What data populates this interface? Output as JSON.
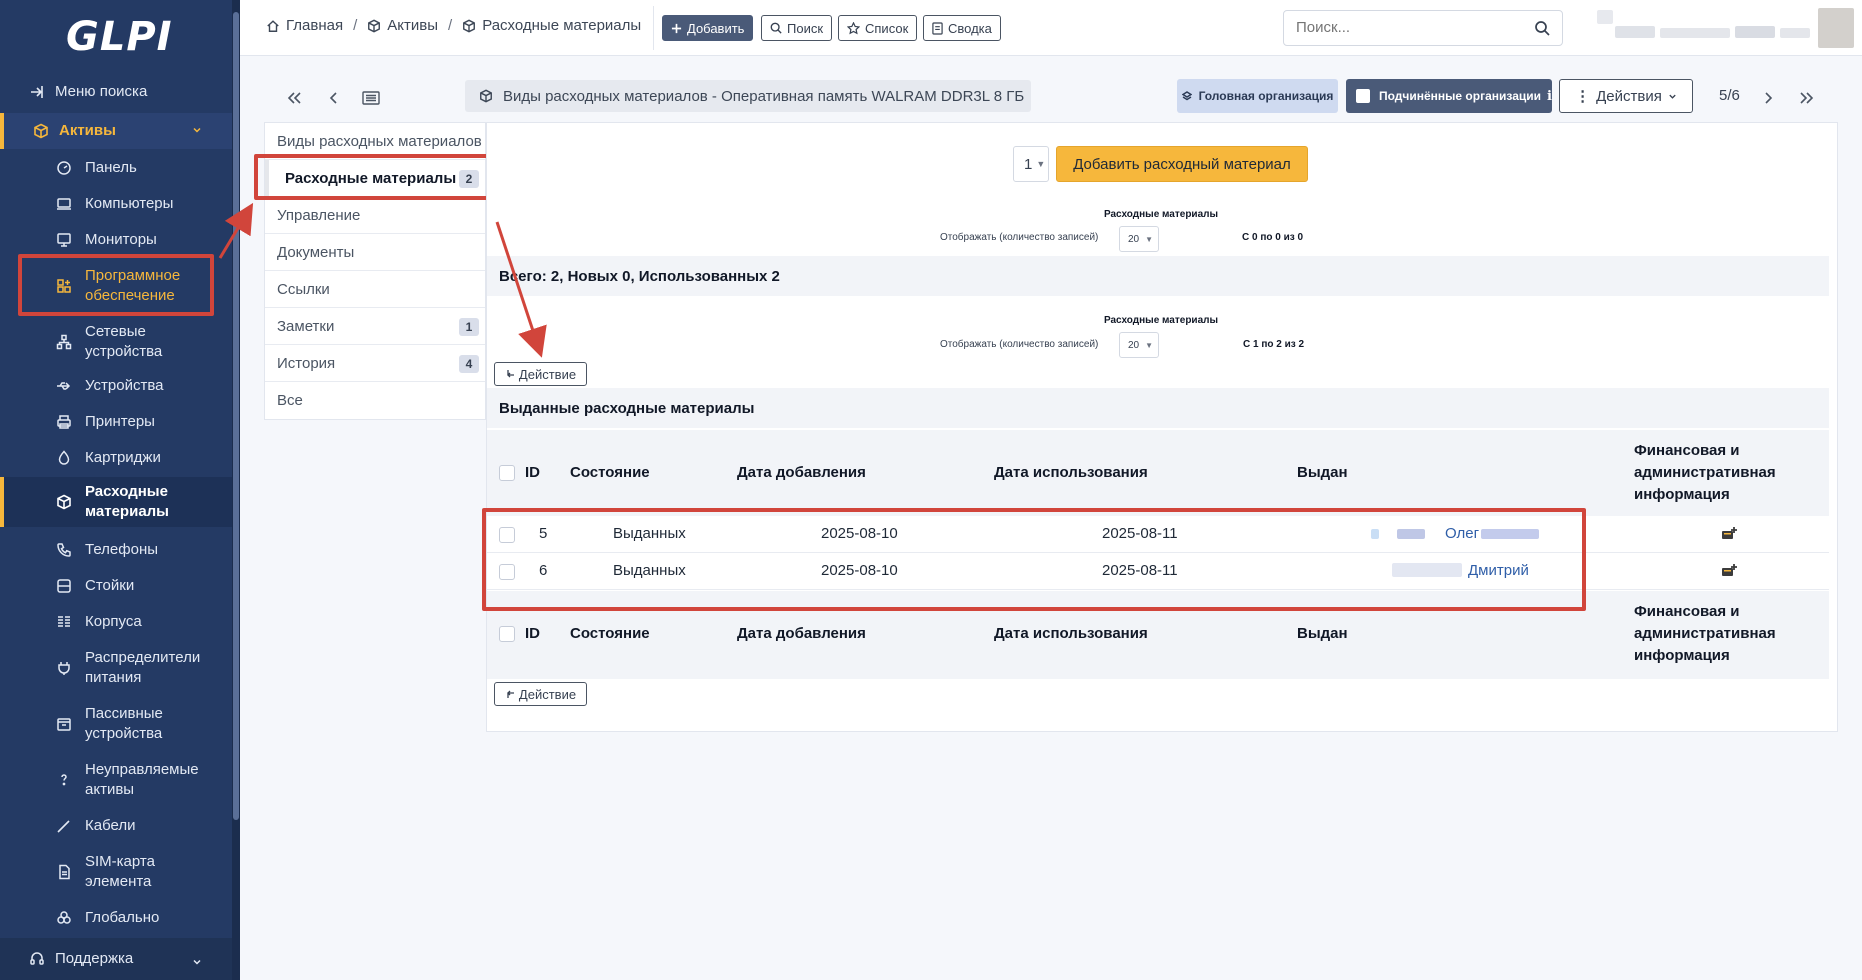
{
  "sidebar": {
    "logo": "GLPI",
    "search_menu": "Меню поиска",
    "section": "Активы",
    "items": [
      {
        "label": "Панель",
        "icon": "dashboard-icon"
      },
      {
        "label": "Компьютеры",
        "icon": "computer-icon"
      },
      {
        "label": "Мониторы",
        "icon": "monitor-icon"
      },
      {
        "label": "Программное обеспечение",
        "icon": "apps-icon"
      },
      {
        "label": "Сетевые устройства",
        "icon": "network-icon"
      },
      {
        "label": "Устройства",
        "icon": "usb-icon"
      },
      {
        "label": "Принтеры",
        "icon": "printer-icon"
      },
      {
        "label": "Картриджи",
        "icon": "droplet-icon"
      },
      {
        "label": "Расходные материалы",
        "icon": "package-icon"
      },
      {
        "label": "Телефоны",
        "icon": "phone-icon"
      },
      {
        "label": "Стойки",
        "icon": "server-icon"
      },
      {
        "label": "Корпуса",
        "icon": "columns-icon"
      },
      {
        "label": "Распределители питания",
        "icon": "plug-icon"
      },
      {
        "label": "Пассивные устройства",
        "icon": "box-icon"
      },
      {
        "label": "Неуправляемые активы",
        "icon": "question-icon"
      },
      {
        "label": "Кабели",
        "icon": "cable-icon"
      },
      {
        "label": "SIM-карта элемента",
        "icon": "sim-icon"
      },
      {
        "label": "Глобально",
        "icon": "world-icon"
      }
    ],
    "support": "Поддержка"
  },
  "topbar": {
    "breadcrumb": [
      "Главная",
      "Активы",
      "Расходные материалы"
    ],
    "add": "Добавить",
    "search": "Поиск",
    "list": "Список",
    "summary": "Сводка",
    "search_placeholder": "Поиск..."
  },
  "header": {
    "item_title": "Виды расходных материалов - Оперативная память WALRAM DDR3L 8 ГБ",
    "entity": "Головная организация",
    "subentities": "Подчинённые организации",
    "actions": "Действия",
    "pager": "5/6"
  },
  "tabs": [
    {
      "label": "Виды расходных материалов",
      "badge": ""
    },
    {
      "label": "Расходные материалы",
      "badge": "2"
    },
    {
      "label": "Управление",
      "badge": ""
    },
    {
      "label": "Документы",
      "badge": ""
    },
    {
      "label": "Ссылки",
      "badge": ""
    },
    {
      "label": "Заметки",
      "badge": "1"
    },
    {
      "label": "История",
      "badge": "4"
    },
    {
      "label": "Все",
      "badge": ""
    }
  ],
  "main": {
    "qty": "1",
    "add_consumable": "Добавить расходный материал",
    "pager_title": "Расходные материалы",
    "per_page_label": "Отображать (количество записей)",
    "per_page": "20",
    "count_new": "С 0 по 0 из 0",
    "count_used": "С 1 по 2 из 2",
    "totals": "Всего: 2, Новых 0, Использованных 2",
    "action": "Действие",
    "section_title": "Выданные расходные материалы",
    "columns": {
      "id": "ID",
      "state": "Состояние",
      "date_add": "Дата добавления",
      "date_use": "Дата использования",
      "given_to": "Выдан",
      "financial": "Финансовая и административная информация"
    },
    "rows": [
      {
        "id": "5",
        "state": "Выданных",
        "date_add": "2025-08-10",
        "date_use": "2025-08-11",
        "given_to": "Олег"
      },
      {
        "id": "6",
        "state": "Выданных",
        "date_add": "2025-08-10",
        "date_use": "2025-08-11",
        "given_to": "Дмитрий"
      }
    ]
  },
  "colors": {
    "sidebar_bg": "#243a64",
    "accent": "#f6b73c",
    "annotation_red": "#d1453b",
    "link": "#2f5ea8"
  }
}
